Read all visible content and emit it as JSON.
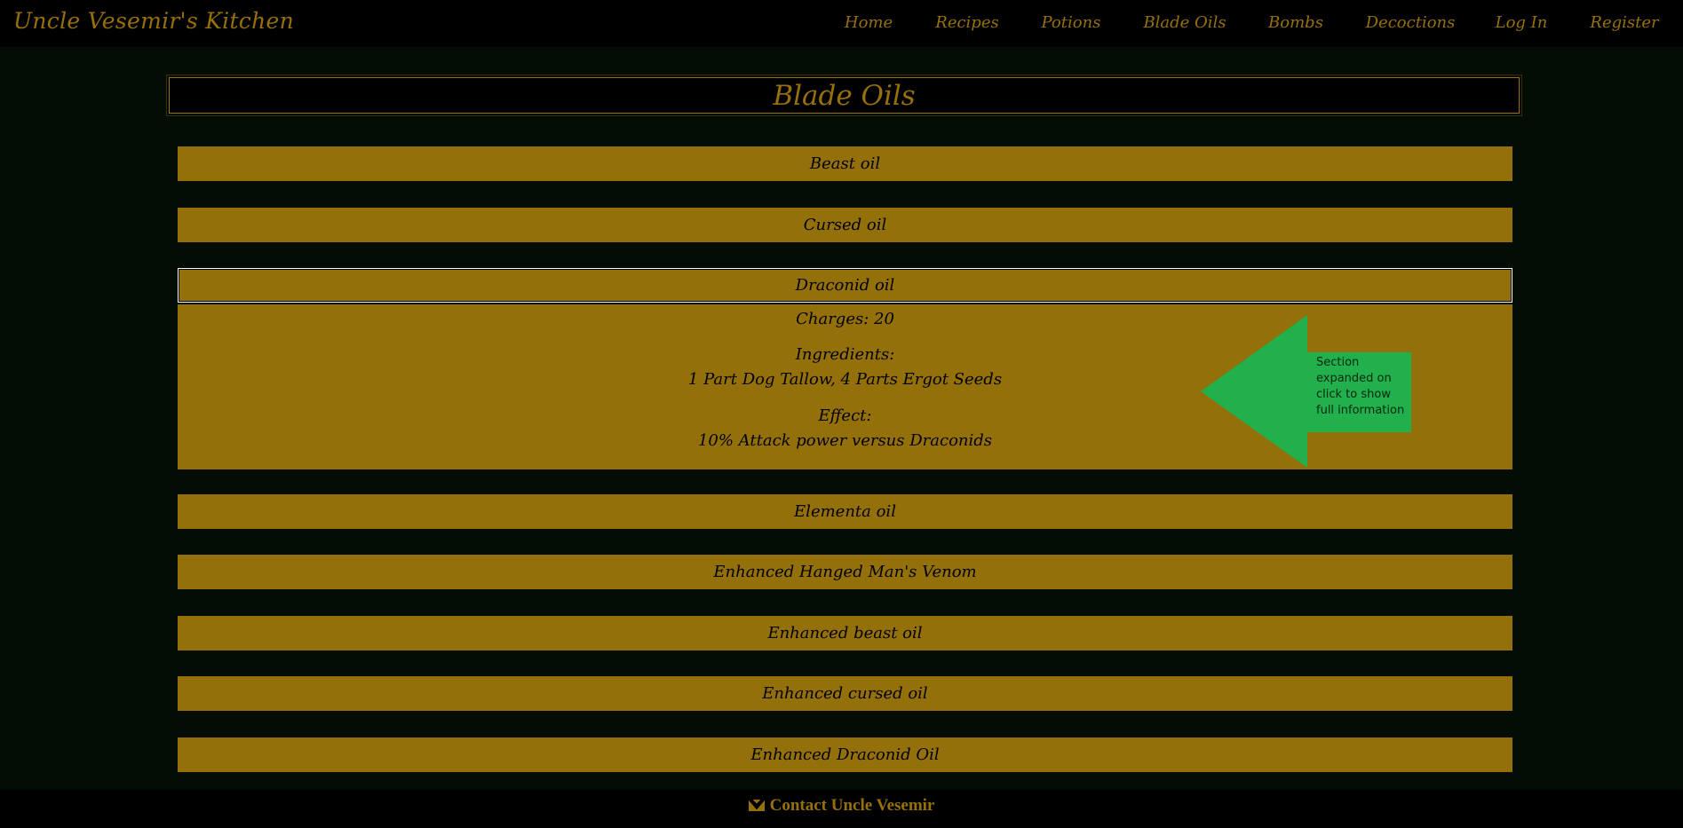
{
  "brand": "Uncle Vesemir's Kitchen",
  "nav": {
    "items": [
      "Home",
      "Recipes",
      "Potions",
      "Blade Oils",
      "Bombs",
      "Decoctions",
      "Log In",
      "Register"
    ]
  },
  "page_title": "Blade Oils",
  "oils": [
    {
      "name": "Beast oil"
    },
    {
      "name": "Cursed oil"
    },
    {
      "name": "Draconid oil",
      "expanded": true
    },
    {
      "name": "Elementa oil"
    },
    {
      "name": "Enhanced Hanged Man's Venom"
    },
    {
      "name": "Enhanced beast oil"
    },
    {
      "name": "Enhanced cursed oil"
    },
    {
      "name": "Enhanced Draconid Oil"
    }
  ],
  "details": {
    "charges": "Charges: 20",
    "ingredients_label": "Ingredients:",
    "ingredients": "1 Part Dog Tallow, 4 Parts Ergot Seeds",
    "effect_label": "Effect:",
    "effect": "10% Attack power versus Draconids"
  },
  "annotation": {
    "text": "Section expanded on click to show full information",
    "color": "#21b04b"
  },
  "footer": {
    "icon": "envelope-icon",
    "label": "Contact Uncle Vesemir"
  },
  "colors": {
    "background": "#030c05",
    "bar": "#000000",
    "gold": "#96700b",
    "panel": "#94700b"
  }
}
